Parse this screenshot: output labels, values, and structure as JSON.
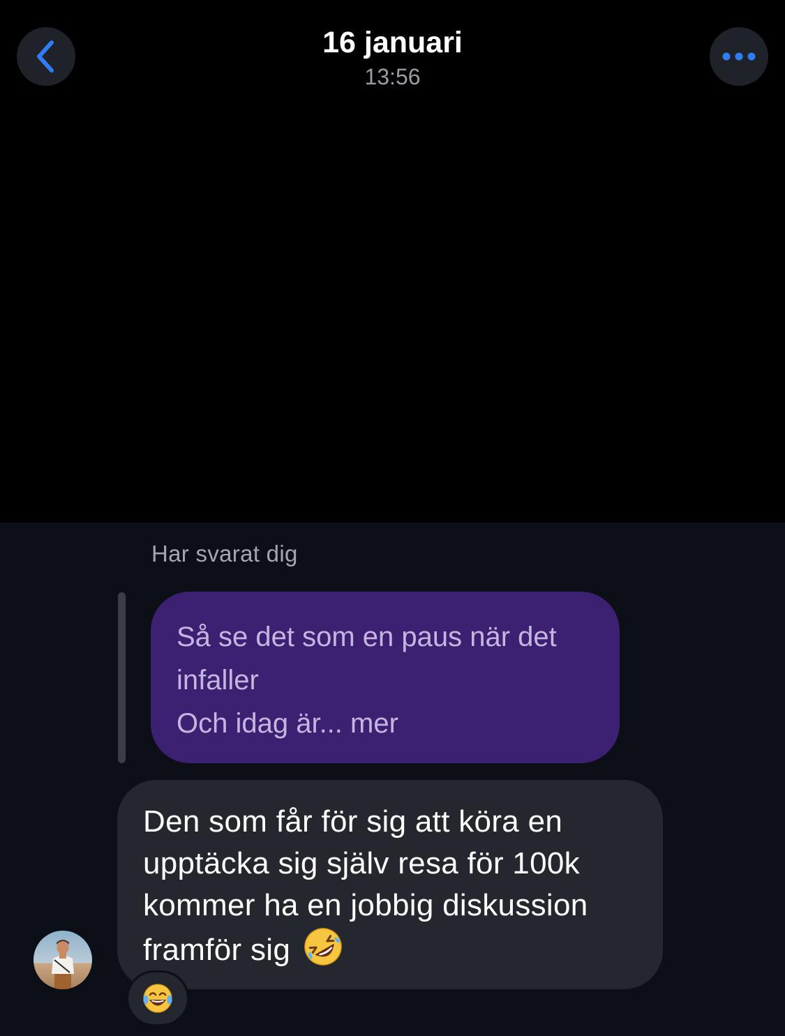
{
  "header": {
    "date": "16 januari",
    "time": "13:56",
    "back_icon": "chevron-left-icon",
    "more_icon": "ellipsis-icon",
    "accent_color": "#2f7cf6"
  },
  "reply": {
    "label": "Har svarat dig",
    "quoted_lines": [
      "Så se det som en paus när det",
      "infaller",
      "Och idag är... mer"
    ]
  },
  "message": {
    "lines": [
      "Den som får för sig att köra en",
      "upptäcka sig själv resa för 100k",
      "kommer ha en jobbig diskussion",
      "framför sig"
    ],
    "emoji": "rolling-on-floor-laughing-emoji",
    "reaction": "face-with-tears-of-joy-emoji"
  },
  "colors": {
    "quoted_bubble": "#3c2071",
    "message_bubble": "#24272d",
    "background": "#0c0f15"
  }
}
